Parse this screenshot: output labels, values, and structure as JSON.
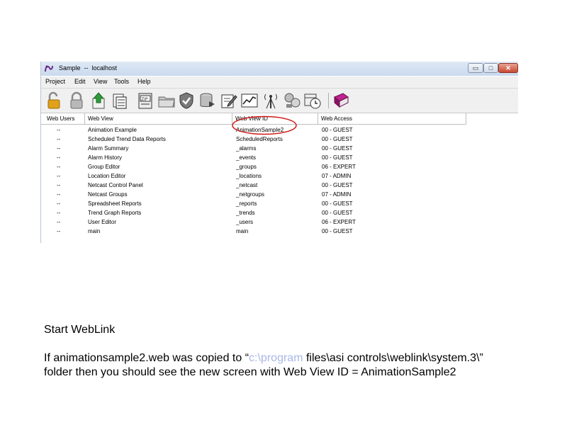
{
  "window": {
    "title": "Sample  --  localhost",
    "controls": {
      "minimize": "▭",
      "maximize": "□",
      "close": "✕"
    }
  },
  "menu": [
    "Project",
    "Edit",
    "View",
    "Tools",
    "Help"
  ],
  "toolbar_icons": [
    "unlock-icon",
    "lock-icon",
    "upload-icon",
    "report-icon",
    "zip-icon",
    "folder-icon",
    "shield-icon",
    "database-icon",
    "edit-form-icon",
    "trend-chart-icon",
    "antenna-icon",
    "network-icon",
    "scheduler-icon",
    "book-icon"
  ],
  "table": {
    "columns": [
      "Web Users",
      "Web View",
      "Web View ID",
      "Web Access"
    ],
    "rows": [
      {
        "users": "--",
        "view": "Animation Example",
        "id": "AnimationSample2",
        "access": "00 - GUEST"
      },
      {
        "users": "--",
        "view": "Scheduled Trend Data Reports",
        "id": "ScheduledReports",
        "access": "00 - GUEST"
      },
      {
        "users": "--",
        "view": "Alarm Summary",
        "id": "_alarms",
        "access": "00 - GUEST"
      },
      {
        "users": "--",
        "view": "Alarm History",
        "id": "_events",
        "access": "00 - GUEST"
      },
      {
        "users": "--",
        "view": "Group Editor",
        "id": "_groups",
        "access": "06 - EXPERT"
      },
      {
        "users": "--",
        "view": "Location Editor",
        "id": "_locations",
        "access": "07 - ADMIN"
      },
      {
        "users": "--",
        "view": "Netcast Control Panel",
        "id": "_netcast",
        "access": "00 - GUEST"
      },
      {
        "users": "--",
        "view": "Netcast Groups",
        "id": "_netgroups",
        "access": "07 - ADMIN"
      },
      {
        "users": "--",
        "view": "Spreadsheet Reports",
        "id": "_reports",
        "access": "00 - GUEST"
      },
      {
        "users": "--",
        "view": "Trend Graph Reports",
        "id": "_trends",
        "access": "00 - GUEST"
      },
      {
        "users": "--",
        "view": "User Editor",
        "id": "_users",
        "access": "06 - EXPERT"
      },
      {
        "users": "--",
        "view": "main",
        "id": "main",
        "access": "00 - GUEST"
      }
    ]
  },
  "slide": {
    "heading": "Start WebLink",
    "para_line1_a": "If animationsample2.web was copied to “",
    "para_line1_path": "c:\\program",
    "para_line1_b": " files\\asi controls\\weblink\\system.3\\”",
    "para_line2": "folder then you should see the new screen with Web View ID = AnimationSample2"
  },
  "colors": {
    "highlight_circle": "#d01818",
    "path_text": "#a9b7e6",
    "titlebar": "#c9d9ee"
  }
}
